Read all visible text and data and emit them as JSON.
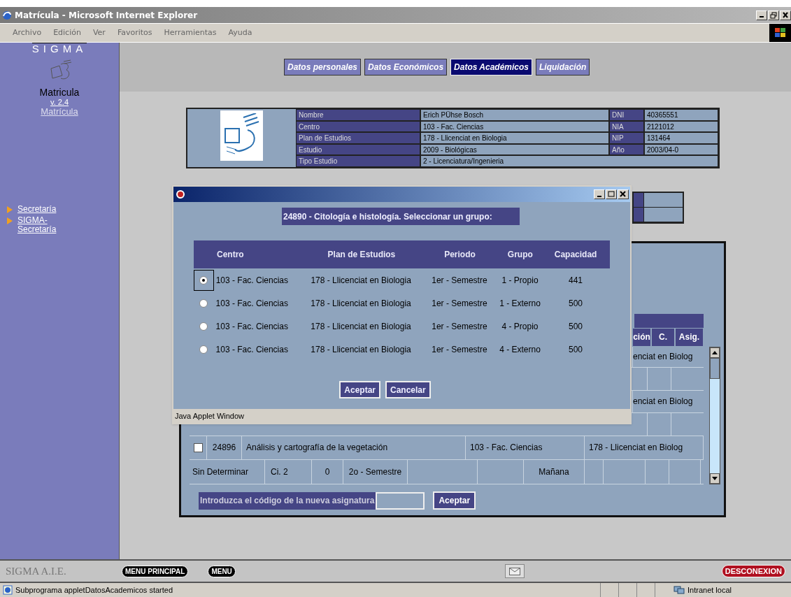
{
  "window": {
    "title": "Matrícula - Microsoft Internet Explorer"
  },
  "menu_bar": [
    "Archivo",
    "Edición",
    "Ver",
    "Favoritos",
    "Herramientas",
    "Ayuda"
  ],
  "sidebar": {
    "brand": "SIGMA",
    "app_name": "Matricula",
    "version": "v. 2.4",
    "link": "Matrícula",
    "nav_items": [
      "Secretaría",
      "SIGMA-Secretaría"
    ]
  },
  "tabs": [
    {
      "label": "Datos personales",
      "selected": false
    },
    {
      "label": "Datos Económicos",
      "selected": false
    },
    {
      "label": "Datos Académicos",
      "selected": true
    },
    {
      "label": "Liquidación",
      "selected": false
    }
  ],
  "student_info": {
    "fields": [
      {
        "label": "Nombre",
        "value": "Erich PÜhse Bosch"
      },
      {
        "label": "Centro",
        "value": "103 - Fac. Ciencias"
      },
      {
        "label": "Plan de Estudios",
        "value": "178 - Llicenciat en Biologia"
      },
      {
        "label": "Estudio",
        "value": "2009 - Biológicas"
      },
      {
        "label": "Tipo Estudio",
        "value": "2 - Licenciatura/Ingenieria"
      }
    ],
    "side_fields": [
      {
        "label": "DNI",
        "value": "40365551"
      },
      {
        "label": "NIA",
        "value": "2121012"
      },
      {
        "label": "NIP",
        "value": "131464"
      },
      {
        "label": "Año",
        "value": "2003/04-0"
      }
    ]
  },
  "subjects_panel": {
    "header_fragments": [
      "ción",
      "C.",
      "Asig."
    ],
    "rows": [
      {
        "kind": "continuation",
        "text": "enciat en Biolog"
      },
      {
        "kind": "blank"
      },
      {
        "kind": "continuation",
        "text": "enciat en Biolog"
      },
      {
        "kind": "blank"
      },
      {
        "kind": "subject",
        "checked": false,
        "cells": [
          "24896",
          "Análisis y cartografía de la vegetación",
          "103 - Fac. Ciencias",
          "178 - Llicenciat en Biolog"
        ]
      },
      {
        "kind": "detail",
        "cells": [
          "Sin Determinar",
          "Ci. 2",
          "0",
          "2o - Semestre",
          "Mañana"
        ]
      }
    ],
    "code_prompt": {
      "label": "Introduzca el código de la nueva asignatura",
      "button": "Aceptar"
    }
  },
  "dialog": {
    "heading": "24890 - Citología e histología. Seleccionar un grupo:",
    "columns": [
      "Centro",
      "Plan de Estudios",
      "Periodo",
      "Grupo",
      "Capacidad"
    ],
    "rows": [
      {
        "selected": true,
        "cells": [
          "103 - Fac. Ciencias",
          "178 - Llicenciat en Biologia",
          "1er - Semestre",
          "1 - Propio",
          "441"
        ]
      },
      {
        "selected": false,
        "cells": [
          "103 - Fac. Ciencias",
          "178 - Llicenciat en Biologia",
          "1er - Semestre",
          "1 - Externo",
          "500"
        ]
      },
      {
        "selected": false,
        "cells": [
          "103 - Fac. Ciencias",
          "178 - Llicenciat en Biologia",
          "1er - Semestre",
          "4 - Propio",
          "500"
        ]
      },
      {
        "selected": false,
        "cells": [
          "103 - Fac. Ciencias",
          "178 - Llicenciat en Biologia",
          "1er - Semestre",
          "4 - Externo",
          "500"
        ]
      }
    ],
    "buttons": [
      "Aceptar",
      "Cancelar"
    ],
    "footer": "Java Applet Window"
  },
  "bottom_bar": {
    "brand": "SIGMA A.I.E.",
    "buttons": [
      "MENU PRINCIPAL",
      "MENU"
    ],
    "logout": "DESCONEXION"
  },
  "status_bar": {
    "message": "Subprograma appletDatosAcademicos started",
    "zone": "Intranet local"
  }
}
